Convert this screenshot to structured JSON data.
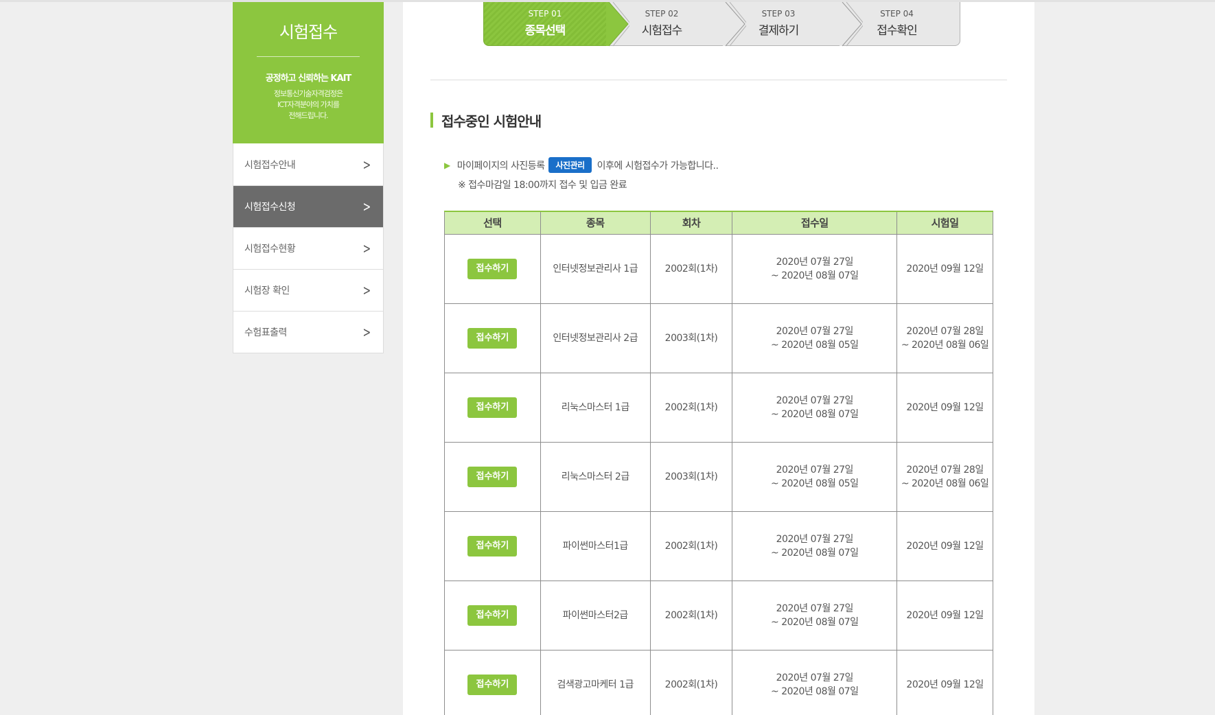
{
  "sidebar": {
    "title": "시험접수",
    "slogan": "공정하고 신뢰하는 KAIT",
    "desc_line1": "정보통신기술자격검정은",
    "desc_line2": "ICT자격분야의 가치를",
    "desc_line3": "전해드립니다.",
    "items": [
      {
        "label": "시험접수안내"
      },
      {
        "label": "시험접수신청"
      },
      {
        "label": "시험접수현황"
      },
      {
        "label": "시험장 확인"
      },
      {
        "label": "수험표출력"
      }
    ]
  },
  "steps": [
    {
      "num": "STEP 01",
      "label": "종목선택"
    },
    {
      "num": "STEP 02",
      "label": "시험접수"
    },
    {
      "num": "STEP 03",
      "label": "결제하기"
    },
    {
      "num": "STEP 04",
      "label": "접수확인"
    }
  ],
  "section_title": "접수중인 시험안내",
  "notice": {
    "prefix": "마이페이지의 사진등록",
    "badge": "사진관리",
    "suffix": "이후에 시험접수가 가능합니다..",
    "deadline": "※ 접수마감일 18:00까지 접수 및 입금 완료"
  },
  "table": {
    "headers": [
      "선택",
      "종목",
      "회차",
      "접수일",
      "시험일"
    ],
    "apply_label": "접수하기",
    "rows": [
      {
        "subject": "인터넷정보관리사 1급",
        "round": "2002회(1차)",
        "reg1": "2020년 07월 27일",
        "reg2": "~ 2020년 08월 07일",
        "exam1": "2020년 09월 12일",
        "exam2": ""
      },
      {
        "subject": "인터넷정보관리사 2급",
        "round": "2003회(1차)",
        "reg1": "2020년 07월 27일",
        "reg2": "~ 2020년 08월 05일",
        "exam1": "2020년 07월 28일",
        "exam2": "~ 2020년 08월 06일"
      },
      {
        "subject": "리눅스마스터 1급",
        "round": "2002회(1차)",
        "reg1": "2020년 07월 27일",
        "reg2": "~ 2020년 08월 07일",
        "exam1": "2020년 09월 12일",
        "exam2": ""
      },
      {
        "subject": "리눅스마스터 2급",
        "round": "2003회(1차)",
        "reg1": "2020년 07월 27일",
        "reg2": "~ 2020년 08월 05일",
        "exam1": "2020년 07월 28일",
        "exam2": "~ 2020년 08월 06일"
      },
      {
        "subject": "파이썬마스터1급",
        "round": "2002회(1차)",
        "reg1": "2020년 07월 27일",
        "reg2": "~ 2020년 08월 07일",
        "exam1": "2020년 09월 12일",
        "exam2": ""
      },
      {
        "subject": "파이썬마스터2급",
        "round": "2002회(1차)",
        "reg1": "2020년 07월 27일",
        "reg2": "~ 2020년 08월 07일",
        "exam1": "2020년 09월 12일",
        "exam2": ""
      },
      {
        "subject": "검색광고마케터 1급",
        "round": "2002회(1차)",
        "reg1": "2020년 07월 27일",
        "reg2": "~ 2020년 08월 07일",
        "exam1": "2020년 09월 12일",
        "exam2": ""
      }
    ]
  },
  "colors": {
    "accent": "#8cc63f",
    "active_menu": "#6b6b6b",
    "badge": "#1a6fc9",
    "header_bg": "#d4eeb4"
  }
}
